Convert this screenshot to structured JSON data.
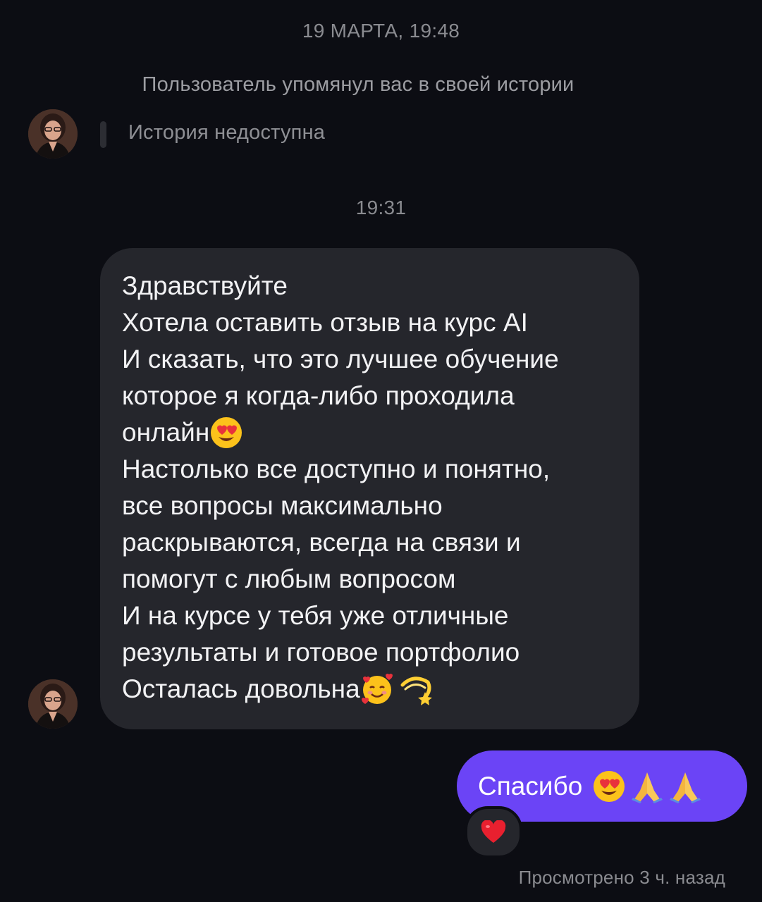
{
  "thread": {
    "date_header": "19 МАРТА, 19:48",
    "mention_note": "Пользователь упомянул вас в своей истории",
    "story_unavailable": "История недоступна",
    "time_header": "19:31"
  },
  "incoming_message": {
    "lines": [
      {
        "text": "Здравствуйте"
      },
      {
        "text": "Хотела оставить отзыв на курс AI"
      },
      {
        "text": "И сказать, что это лучшее обучение"
      },
      {
        "text": "которое я когда-либо проходила"
      },
      {
        "text": "онлайн",
        "emoji": [
          "heart-eyes-emoji"
        ]
      },
      {
        "text": "Настолько все доступно и понятно,"
      },
      {
        "text": "все вопросы максимально"
      },
      {
        "text": "раскрываются, всегда на связи и"
      },
      {
        "text": "помогут с любым вопросом"
      },
      {
        "text": "И на курсе у тебя уже отличные"
      },
      {
        "text": "результаты и готовое портфолио"
      },
      {
        "text": "Осталась довольна",
        "emoji": [
          "smiling-face-with-hearts-emoji",
          "dizzy-emoji"
        ]
      }
    ]
  },
  "outgoing_message": {
    "text": "Спасибо",
    "emoji": [
      "heart-eyes-emoji",
      "folded-hands-emoji",
      "folded-hands-emoji"
    ],
    "reaction": "red-heart-emoji"
  },
  "seen_status": "Просмотрено 3 ч. назад",
  "colors": {
    "background": "#0c0d13",
    "incoming_bubble": "#25262c",
    "outgoing_bubble": "#6b44f6",
    "muted_text": "#8a8b90"
  }
}
